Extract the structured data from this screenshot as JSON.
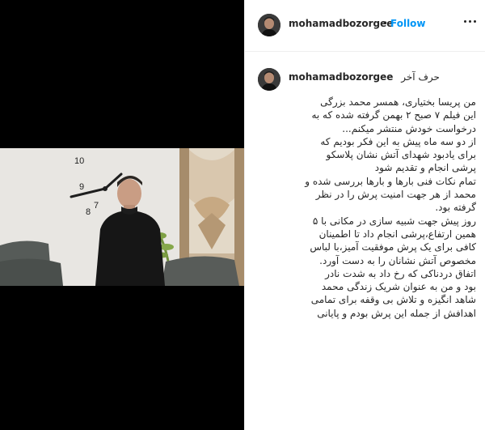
{
  "header": {
    "username": "mohamadbozorgee",
    "separator": "•",
    "follow_label": "Follow",
    "more_icon": "more-options-icon"
  },
  "caption": {
    "username": "mohamadbozorgee",
    "title": "حرف آخر",
    "lines": [
      "من پریسا بختیاری، همسر محمد بزرگی",
      "این فیلم ۷ صبح ۲ بهمن گرفته شده که به",
      "درخواست خودش منتشر میکنم...",
      "از دو سه ماه پیش به این فکر بودیم که",
      "برای یادبود شهدای آتش نشان پلاسکو",
      "پرشی انجام و تقدیم شود",
      "تمام نکات فنی بارها و بارها بررسی شده و",
      "محمد از هر جهت امنیت پرش را در نظر",
      "گرفته بود.",
      "روز پیش جهت شبیه سازی در مکانی با ۵",
      "همین ارتفاع،پرشی انجام داد تا اطمینان",
      "کافی برای یک پرش موفقیت آمیز،با لباس",
      "مخصوص آتش نشانان را به دست آورد.",
      "اتفاق دردناکی که رخ داد به شدت نادر",
      "بود و من به عنوان شریک زندگی محمد",
      "شاهد انگیزه و تلاش بی وقفه برای تمامی",
      "اهدافش از جمله این پرش بودم و پایانی"
    ]
  },
  "video": {
    "clock_numbers": [
      "10",
      "9",
      "8",
      "7"
    ]
  },
  "colors": {
    "link": "#0095f6",
    "text": "#262626",
    "media_bg": "#000000"
  }
}
